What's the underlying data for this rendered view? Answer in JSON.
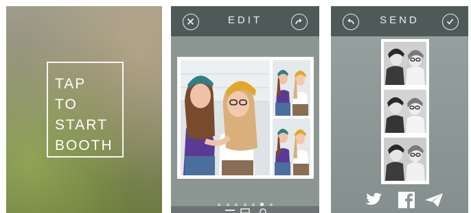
{
  "start_screen": {
    "lines": [
      "TAP",
      "TO",
      "START",
      "BOOTH"
    ]
  },
  "edit_screen": {
    "title": "EDIT",
    "close_icon": "close-icon",
    "share_icon": "share-arrow-icon",
    "page_dots_total": 7,
    "page_dots_active_index": 5
  },
  "send_screen": {
    "title": "SEND",
    "back_icon": "back-arrow-icon",
    "done_icon": "checkmark-icon",
    "share_icons": [
      "twitter-icon",
      "facebook-icon",
      "paper-plane-icon"
    ]
  },
  "colors": {
    "topbar": "#4f5a58",
    "edit_background": "#8b9693",
    "send_background": "#8f9a99",
    "beanie_teal": "#2f7f86",
    "beanie_yellow": "#e0a826",
    "shirt_purple": "#6a3e9a"
  }
}
